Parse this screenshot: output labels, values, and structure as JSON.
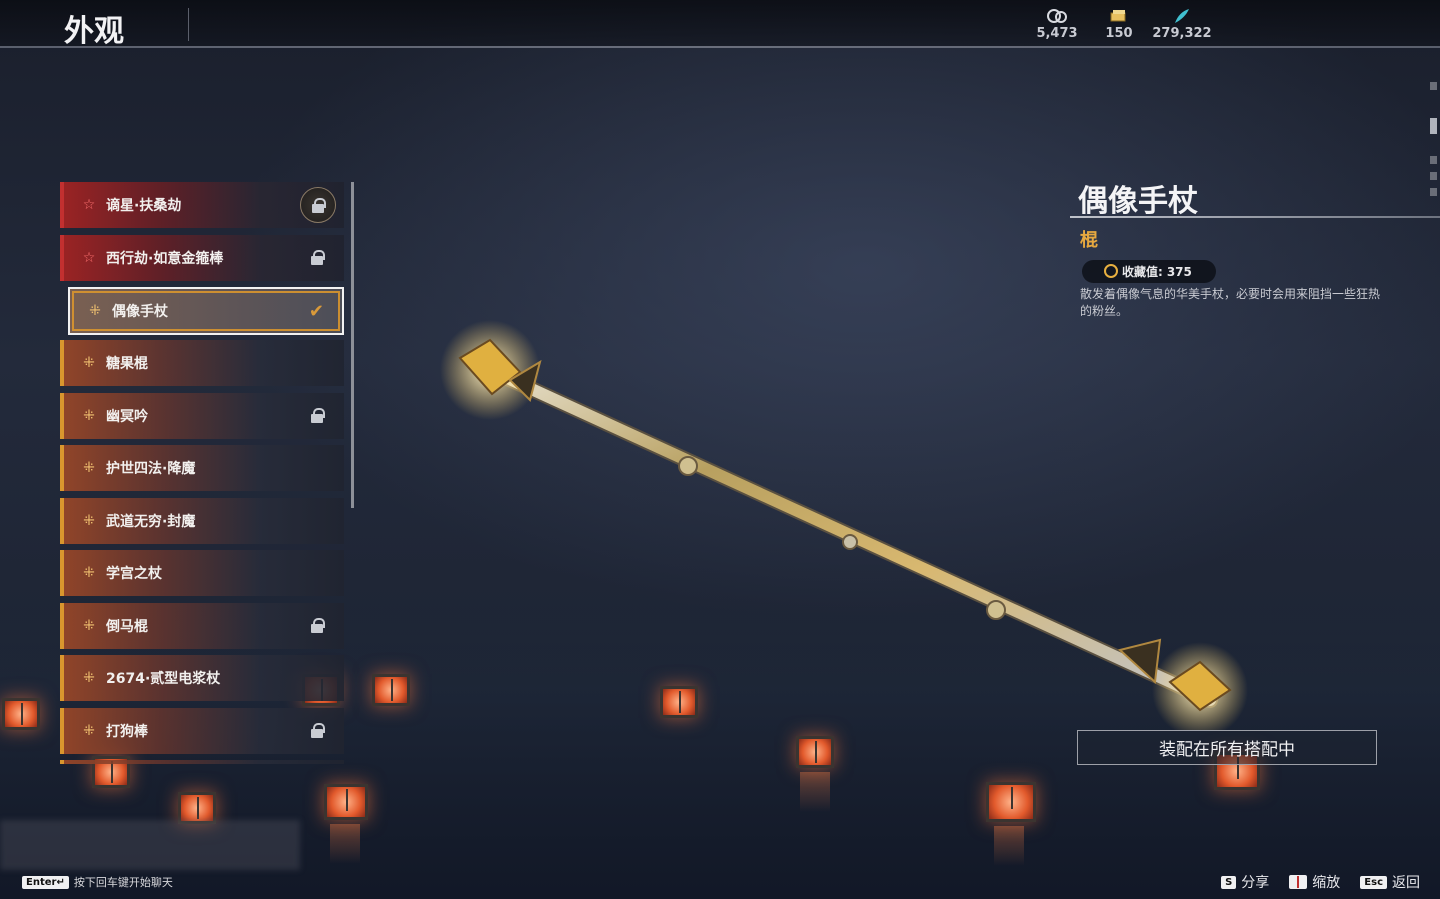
{
  "header": {
    "title": "外观",
    "currencies": [
      {
        "icon": "mask-icon",
        "value": "5,473"
      },
      {
        "icon": "ticket-icon",
        "value": "150"
      },
      {
        "icon": "feather-icon",
        "value": "279,322"
      }
    ]
  },
  "items": [
    {
      "tier": "☆",
      "label": "谪星·扶桑劫",
      "locked": true,
      "rarity": "red"
    },
    {
      "tier": "☆",
      "label": "西行劫·如意金箍棒",
      "locked": true,
      "rarity": "red"
    },
    {
      "tier": "⁜",
      "label": "偶像手杖",
      "locked": false,
      "selected": true
    },
    {
      "tier": "⁜",
      "label": "糖果棍",
      "locked": false
    },
    {
      "tier": "⁜",
      "label": "幽冥吟",
      "locked": true
    },
    {
      "tier": "⁜",
      "label": "护世四法·降魔",
      "locked": false
    },
    {
      "tier": "⁜",
      "label": "武道无穷·封魔",
      "locked": false
    },
    {
      "tier": "⁜",
      "label": "学宫之杖",
      "locked": false
    },
    {
      "tier": "⁜",
      "label": "倒马棍",
      "locked": true
    },
    {
      "tier": "⁜",
      "label": "2674·贰型电浆杖",
      "locked": false
    },
    {
      "tier": "⁜",
      "label": "打狗棒",
      "locked": true
    }
  ],
  "detail": {
    "name": "偶像手杖",
    "type": "棍",
    "collection_label": "收藏值:",
    "collection_value": "375",
    "description": "散发着偶像气息的华美手杖，必要时会用来阻挡一些狂热的粉丝。",
    "equip_button": "装配在所有搭配中"
  },
  "footer": {
    "chat_key": "Enter↵",
    "chat_hint": "按下回车键开始聊天",
    "actions": [
      {
        "key": "S",
        "label": "分享"
      },
      {
        "key": "book-icon",
        "label": "缩放"
      },
      {
        "key": "Esc",
        "label": "返回"
      }
    ]
  },
  "colors": {
    "accent_orange": "#d9962e",
    "accent_red": "#c23030",
    "type_gold": "#e6a840"
  }
}
